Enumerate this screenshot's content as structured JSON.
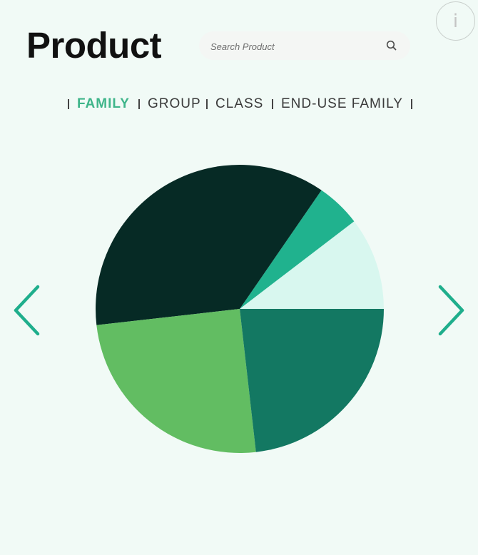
{
  "header": {
    "title": "Product",
    "info_label": "i"
  },
  "search": {
    "placeholder": "Search Product",
    "value": ""
  },
  "tabs": [
    {
      "label": "FAMILY",
      "active": true
    },
    {
      "label": "GROUP",
      "active": false
    },
    {
      "label": "CLASS",
      "active": false
    },
    {
      "label": "END-USE FAMILY",
      "active": false
    }
  ],
  "icons": {
    "search": "search-icon",
    "info": "info-icon",
    "prev": "chevron-left-icon",
    "next": "chevron-right-icon"
  },
  "colors": {
    "background": "#f1faf6",
    "accent": "#3fb58a",
    "arrow": "#1fae8c"
  },
  "chart_data": {
    "type": "pie",
    "title": "",
    "start_angle_deg": 0,
    "direction": "counterclockwise",
    "slices": [
      {
        "value": 10.4,
        "color": "#d8f7ef"
      },
      {
        "value": 5.0,
        "color": "#20b28e"
      },
      {
        "value": 36.4,
        "color": "#062a25"
      },
      {
        "value": 25.0,
        "color": "#62bd62"
      },
      {
        "value": 23.2,
        "color": "#137862"
      }
    ]
  }
}
